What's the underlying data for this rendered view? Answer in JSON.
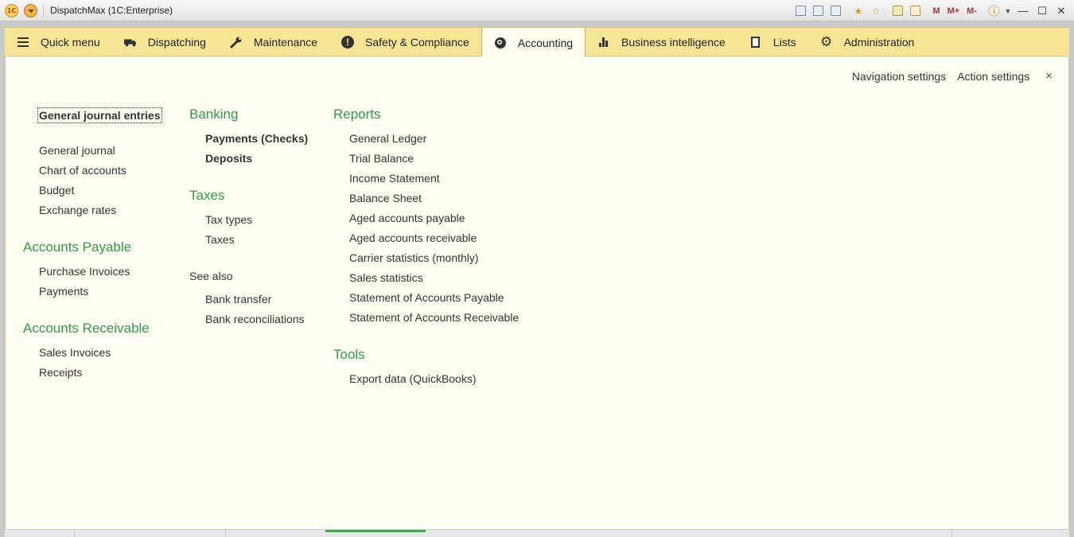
{
  "titlebar": {
    "app_title": "DispatchMax  (1C:Enterprise)",
    "logo_text": "1C",
    "buttons": [
      "save-icon",
      "print-icon",
      "preview-icon",
      "favorites-icon",
      "bookmark-icon",
      "calculator-icon",
      "calendar-icon"
    ],
    "memory": [
      "M",
      "M+",
      "M-"
    ]
  },
  "sections": [
    {
      "label": "Quick menu",
      "icon": "menu-icon"
    },
    {
      "label": "Dispatching",
      "icon": "truck-icon"
    },
    {
      "label": "Maintenance",
      "icon": "wrench-icon"
    },
    {
      "label": "Safety & Compliance",
      "icon": "exclamation-icon"
    },
    {
      "label": "Accounting",
      "icon": "coins-icon",
      "active": true
    },
    {
      "label": "Business intelligence",
      "icon": "bar-chart-icon"
    },
    {
      "label": "Lists",
      "icon": "documents-icon"
    },
    {
      "label": "Administration",
      "icon": "gear-icon"
    }
  ],
  "top_actions": {
    "navigation_settings": "Navigation settings",
    "action_settings": "Action settings",
    "close": "×"
  },
  "col1": {
    "focused": "General journal entries",
    "items": [
      "General journal",
      "Chart of accounts",
      "Budget",
      "Exchange rates"
    ],
    "ap_header": "Accounts Payable",
    "ap_items": [
      "Purchase Invoices",
      "Payments"
    ],
    "ar_header": "Accounts Receivable",
    "ar_items": [
      "Sales Invoices",
      "Receipts"
    ]
  },
  "col2": {
    "banking_header": "Banking",
    "banking_items": [
      "Payments (Checks)",
      "Deposits"
    ],
    "taxes_header": "Taxes",
    "taxes_items": [
      "Tax types",
      "Taxes"
    ],
    "see_also": "See also",
    "see_also_items": [
      "Bank transfer",
      "Bank reconciliations"
    ]
  },
  "col3": {
    "reports_header": "Reports",
    "reports_items": [
      "General Ledger",
      "Trial Balance",
      "Income Statement",
      "Balance Sheet",
      "Aged accounts payable",
      "Aged accounts receivable",
      "Carrier statistics (monthly)",
      "Sales statistics",
      "Statement of Accounts Payable",
      "Statement of Accounts Receivable"
    ],
    "tools_header": "Tools",
    "tools_items": [
      "Export data (QuickBooks)"
    ]
  },
  "colors": {
    "accent_green": "#2f9a4a",
    "section_bar": "#f7e596",
    "workspace": "#fffff3"
  }
}
